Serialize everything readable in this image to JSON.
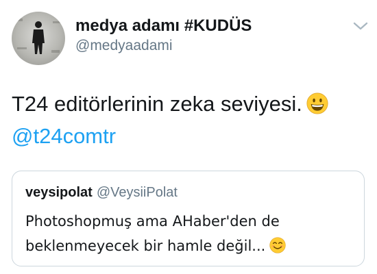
{
  "author": {
    "display_name": "medya adamı #KUDÜS",
    "handle": "@medyaadami"
  },
  "tweet": {
    "text_line1": "T24 editörlerinin zeka seviyesi.",
    "mention": "@t24comtr",
    "emoji": "grinning-face"
  },
  "quoted_tweet": {
    "display_name": "veysipolat",
    "handle": "@VeysiiPolat",
    "text_line1": "Photoshopmuş ama AHaber'den de",
    "text_line2": "beklenmeyecek bir hamle değil...",
    "emoji": "smiling-face-with-smiling-eyes"
  },
  "icons": {
    "menu": "chevron-down-icon"
  },
  "colors": {
    "link": "#1da1f2",
    "secondary_text": "#657786",
    "border": "#ccd6dd",
    "emoji_yellow": "#ffcc33"
  }
}
